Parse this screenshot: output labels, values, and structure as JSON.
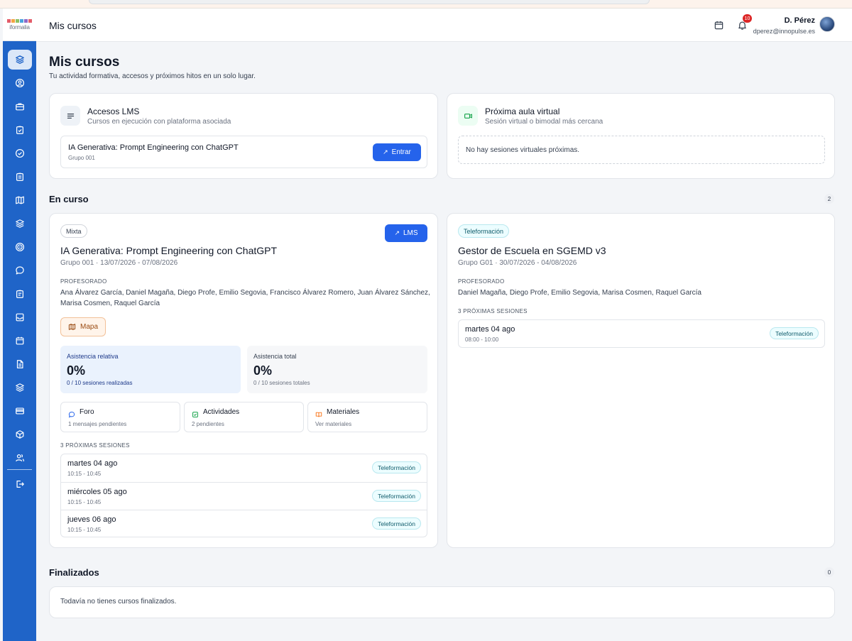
{
  "app": {
    "logo_text": "iformalia",
    "logo_colors": [
      "#e35d6a",
      "#f2a444",
      "#8dc063",
      "#4aa3df",
      "#8e6bc7",
      "#e35d6a"
    ]
  },
  "header": {
    "title": "Mis cursos",
    "notification_count": "10",
    "user_name": "D. Pérez",
    "user_email": "dperez@innopulse.es"
  },
  "page": {
    "title": "Mis cursos",
    "subtitle": "Tu actividad formativa, accesos y próximos hitos en un solo lugar."
  },
  "lms_card": {
    "title": "Accesos LMS",
    "subtitle": "Cursos en ejecución con plataforma asociada",
    "course_name": "IA Generativa: Prompt Engineering con ChatGPT",
    "course_group": "Grupo 001",
    "button_label": "Entrar"
  },
  "virtual_card": {
    "title": "Próxima aula virtual",
    "subtitle": "Sesión virtual o bimodal más cercana",
    "empty_text": "No hay sesiones virtuales próximas."
  },
  "en_curso": {
    "title": "En curso",
    "count": "2"
  },
  "course1": {
    "modality": "Mixta",
    "lms_button": "LMS",
    "title": "IA Generativa: Prompt Engineering con ChatGPT",
    "meta": "Grupo 001 · 13/07/2026 - 07/08/2026",
    "teachers_label": "PROFESORADO",
    "teachers_line1": "Ana Álvarez García, Daniel Magaña, Diego Profe, Emilio Segovia, Francisco Álvarez Romero, Juan Álvarez Sánchez,",
    "teachers_line2": "Marisa Cosmen, Raquel García",
    "map_button": "Mapa",
    "stat_relative": {
      "label": "Asistencia relativa",
      "value": "0%",
      "detail": "0 / 10 sesiones realizadas"
    },
    "stat_total": {
      "label": "Asistencia total",
      "value": "0%",
      "detail": "0 / 10 sesiones totales"
    },
    "foro": {
      "title": "Foro",
      "detail": "1 mensajes pendientes"
    },
    "actividades": {
      "title": "Actividades",
      "detail": "2 pendientes"
    },
    "materiales": {
      "title": "Materiales",
      "detail": "Ver materiales"
    },
    "sessions_label": "3 PRÓXIMAS SESIONES",
    "sessions": [
      {
        "day": "martes 04 ago",
        "hours": "10:15 - 10:45",
        "type": "Teleformación"
      },
      {
        "day": "miércoles 05 ago",
        "hours": "10:15 - 10:45",
        "type": "Teleformación"
      },
      {
        "day": "jueves 06 ago",
        "hours": "10:15 - 10:45",
        "type": "Teleformación"
      }
    ]
  },
  "course2": {
    "modality": "Teleformación",
    "title": "Gestor de Escuela en SGEMD v3",
    "meta": "Grupo G01 · 30/07/2026 - 04/08/2026",
    "teachers_label": "PROFESORADO",
    "teachers_line1": "Daniel Magaña, Diego Profe, Emilio Segovia, Marisa Cosmen, Raquel García",
    "sessions_label": "3 PRÓXIMAS SESIONES",
    "sessions": [
      {
        "day": "martes 04 ago",
        "hours": "08:00 - 10:00",
        "type": "Teleformación"
      }
    ]
  },
  "finalizados": {
    "title": "Finalizados",
    "count": "0",
    "empty_text": "Todavía no tienes cursos finalizados."
  },
  "colors": {
    "sidebar": "#1f64c8",
    "primary_button": "#2563eb",
    "accent_orange": "#f97316",
    "accent_green": "#16a34a"
  }
}
